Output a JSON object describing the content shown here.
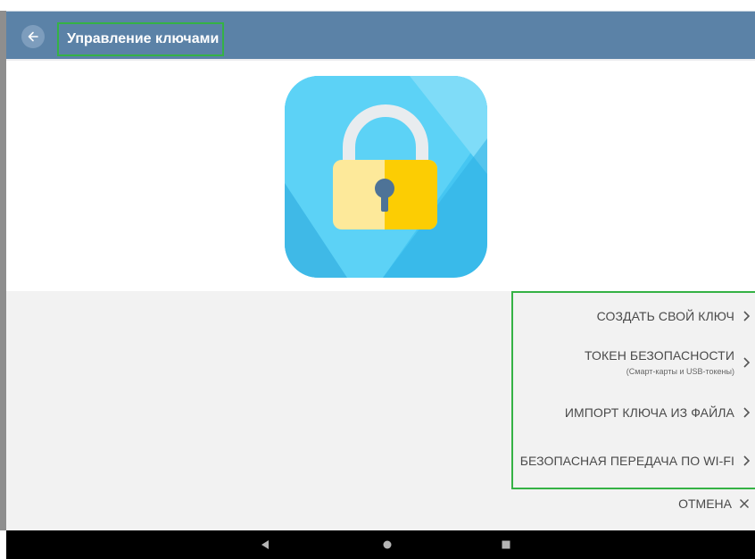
{
  "appbar": {
    "title": "Управление ключами",
    "back_icon": "arrow-left-icon",
    "color": "#5b82a7"
  },
  "logo": {
    "icon": "padlock-app-icon"
  },
  "options": [
    {
      "label": "СОЗДАТЬ СВОЙ КЛЮЧ",
      "sub": ""
    },
    {
      "label": "ТОКЕН БЕЗОПАСНОСТИ",
      "sub": "(Смарт-карты и USB-токены)"
    },
    {
      "label": "ИМПОРТ КЛЮЧА ИЗ ФАЙЛА",
      "sub": ""
    },
    {
      "label": "БЕЗОПАСНАЯ ПЕРЕДАЧА ПО WI-FI",
      "sub": ""
    }
  ],
  "cancel": {
    "label": "ОТМЕНА",
    "icon": "close-icon"
  },
  "navbar": {
    "back_icon": "nav-back-icon",
    "home_icon": "nav-home-icon",
    "recents_icon": "nav-recents-icon"
  },
  "colors": {
    "highlight_border": "#35b245",
    "gray_section": "#f2f2f2"
  }
}
